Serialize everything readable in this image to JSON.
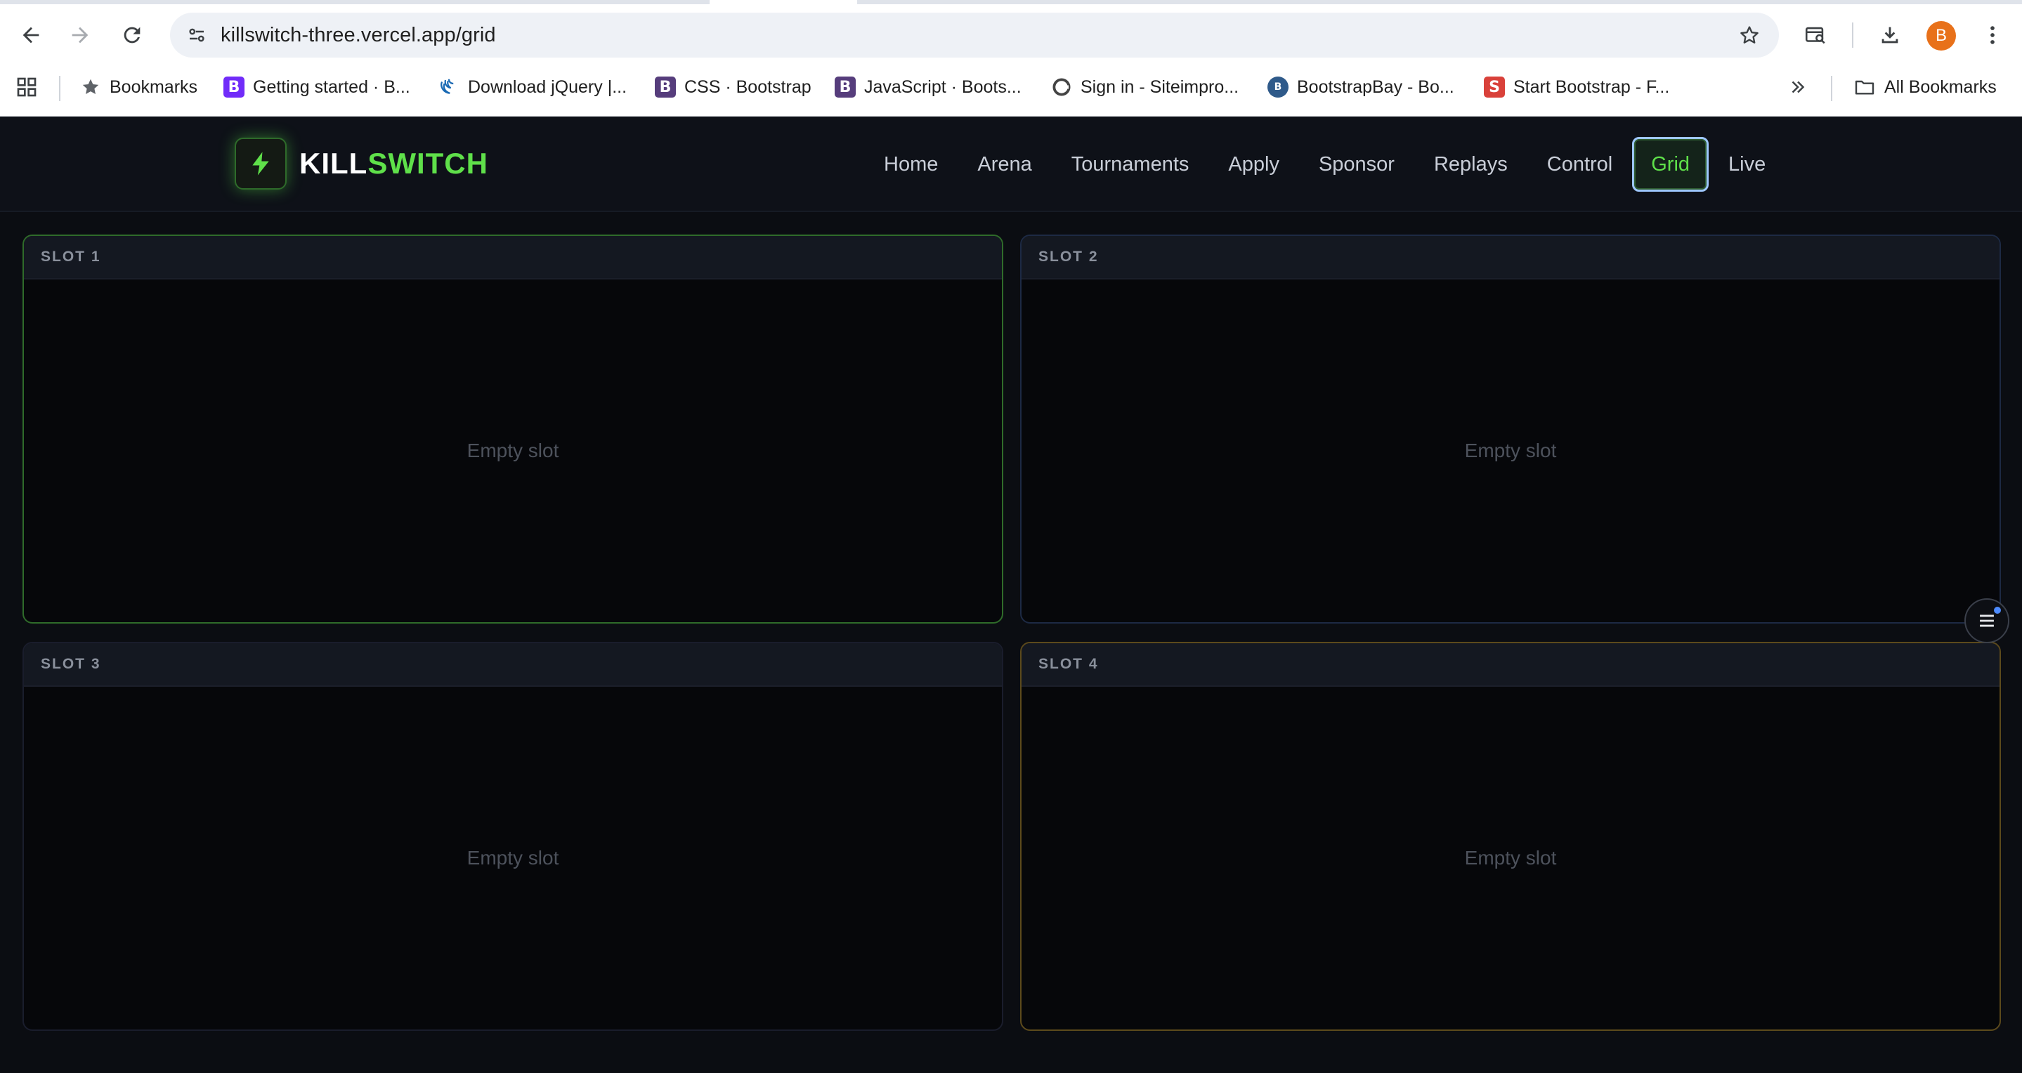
{
  "browser": {
    "url": "killswitch-three.vercel.app/grid",
    "profile_initial": "B",
    "bookmarks": [
      {
        "label": "Bookmarks",
        "icon": "star-icon"
      },
      {
        "label": "Getting started · B...",
        "icon": "bootstrap-icon"
      },
      {
        "label": "Download jQuery |...",
        "icon": "jquery-icon"
      },
      {
        "label": "CSS · Bootstrap",
        "icon": "bootstrap-icon"
      },
      {
        "label": "JavaScript · Boots...",
        "icon": "bootstrap-icon"
      },
      {
        "label": "Sign in - Siteimpro...",
        "icon": "siteimprove-icon"
      },
      {
        "label": "BootstrapBay - Bo...",
        "icon": "bootstrapbay-icon"
      },
      {
        "label": "Start Bootstrap - F...",
        "icon": "startbootstrap-icon"
      }
    ],
    "all_bookmarks": "All Bookmarks",
    "fav_letters": {
      "b": "B",
      "s": "S"
    }
  },
  "site": {
    "logo_part1": "KILL",
    "logo_part2": "SWITCH",
    "nav": [
      "Home",
      "Arena",
      "Tournaments",
      "Apply",
      "Sponsor",
      "Replays",
      "Control",
      "Grid",
      "Live"
    ],
    "active_nav": "Grid",
    "accent_color": "#5fe04a"
  },
  "slots": [
    {
      "label": "SLOT 1",
      "status": "Empty slot",
      "border_color": "#2f6b2a"
    },
    {
      "label": "SLOT 2",
      "status": "Empty slot",
      "border_color": "#1d2a44"
    },
    {
      "label": "SLOT 3",
      "status": "Empty slot",
      "border_color": "#1a1d2c"
    },
    {
      "label": "SLOT 4",
      "status": "Empty slot",
      "border_color": "#5c4a1c"
    }
  ]
}
